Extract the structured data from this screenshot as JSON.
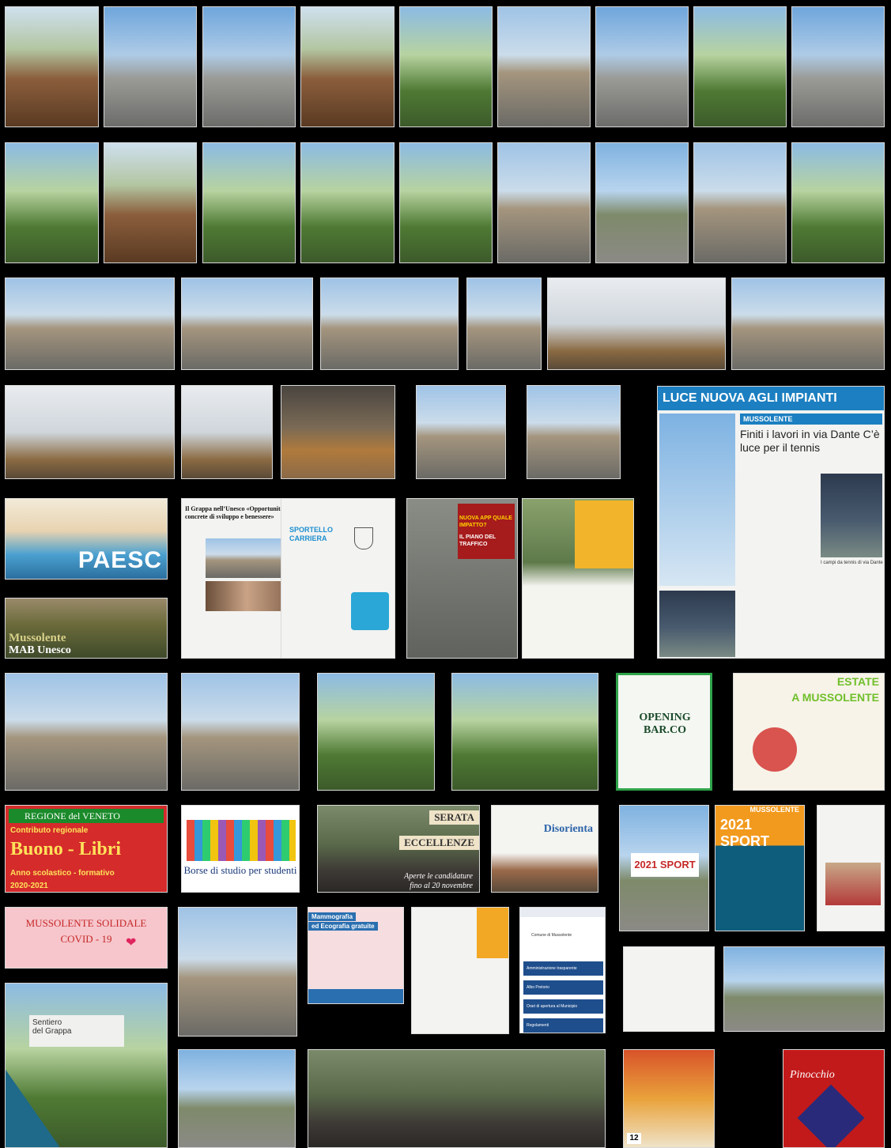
{
  "paesc": {
    "label": "PAESC"
  },
  "mab": {
    "line1": "Mussolente",
    "line2": "MAB Unesco"
  },
  "unesco_article": {
    "headline": "Il Grappa nell’Unesco «Opportunità concrete di sviluppo e benessere»"
  },
  "sportello": {
    "title": "SPORTELLO CARRIERA"
  },
  "traffico": {
    "line1": "NUOVA APP QUALE IMPATTO?",
    "line2": "IL PIANO DEL TRAFFICO"
  },
  "lighting": {
    "banner": "LUCE NUOVA AGLI IMPIANTI SPORTIVI",
    "section": "MUSSOLENTE",
    "headline": "Finiti i lavori in via Dante C’è luce per il tennis",
    "caption": "I campi da tennis di via Dante"
  },
  "opening": {
    "title": "OPENING BAR.CO"
  },
  "estate": {
    "line1": "ESTATE",
    "line2": "A MUSSOLENTE"
  },
  "buono": {
    "header": "REGIONE del VENETO",
    "line1": "Contributo regionale",
    "title": "Buono - Libri",
    "line2": "Anno scolastico - formativo",
    "years": "2020-2021"
  },
  "borse": {
    "title": "Borse di studio per studenti"
  },
  "serata": {
    "label1": "SERATA",
    "label2": "ECCELLENZE",
    "caption1": "Aperte le candidature",
    "caption2": "fino al 20 novembre"
  },
  "disorienta": {
    "title": "Disorienta"
  },
  "sport2021": {
    "title": "2021 SPORT"
  },
  "festa": {
    "small": "MUSSOLENTE",
    "title": "2021 SPORT"
  },
  "covid": {
    "line1": "MUSSOLENTE SOLIDALE",
    "line2": "COVID - 19"
  },
  "mammo": {
    "line1": "Mammografia",
    "line2": "ed Ecografia gratuite"
  },
  "app": {
    "header": "Comune di Mussolente",
    "items": [
      "Amministrazione trasparente",
      "Albo Pretorio",
      "Orari di apertura al Municipio",
      "Regolamenti"
    ]
  },
  "sign": {
    "line1": "Sentiero",
    "line2": "del Grappa"
  },
  "poster_last": {
    "title": "Pinocchio"
  },
  "calendar": {
    "day": "12"
  }
}
